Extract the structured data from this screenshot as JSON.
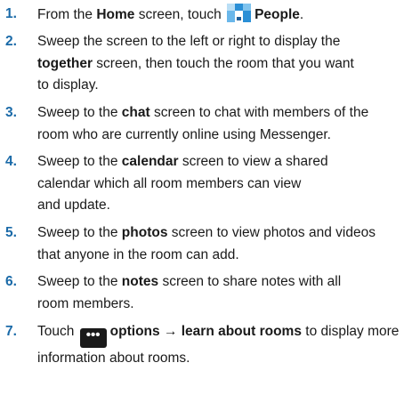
{
  "steps": [
    {
      "num": "1.",
      "a": "From the ",
      "b1": "Home",
      "c": " screen, touch ",
      "b2": "People",
      "d": "."
    },
    {
      "num": "2.",
      "a": "Sweep the screen to the left or right to display the",
      "b1": "together",
      "c": " screen, then touch the room that you want",
      "d": "to display."
    },
    {
      "num": "3.",
      "a": "Sweep to the ",
      "b1": "chat",
      "c": " screen to chat with members of the",
      "d": "room who are currently online using Messenger."
    },
    {
      "num": "4.",
      "a": "Sweep to the ",
      "b1": "calendar",
      "c": " screen to view a shared",
      "d": "calendar which all room members can view",
      "e": "and update."
    },
    {
      "num": "5.",
      "a": "Sweep to the ",
      "b1": "photos",
      "c": " screen to view photos and videos",
      "d": "that anyone in the room can add."
    },
    {
      "num": "6.",
      "a": "Sweep to the ",
      "b1": "notes",
      "c": " screen to share notes with all",
      "d": "room members."
    },
    {
      "num": "7.",
      "a": "Touch ",
      "icon": "•••",
      "b1": "options → learn about rooms",
      "c": " to display more",
      "d": "information about rooms."
    }
  ],
  "icons": {
    "people": "people-icon",
    "options": "options-icon"
  },
  "colors": {
    "step_number": "#1a6aa8",
    "people_icon_blue": "#2a8fd6",
    "people_icon_light": "#b9def5"
  }
}
